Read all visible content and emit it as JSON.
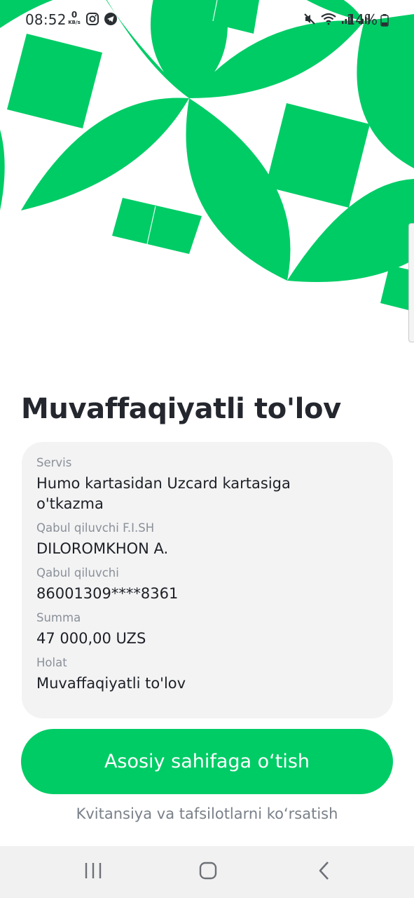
{
  "status_bar": {
    "time": "08:52",
    "net_speed_value": "0",
    "net_speed_unit": "KB/s",
    "battery": "14%",
    "icons_left": [
      "instagram-icon",
      "telegram-icon"
    ],
    "icons_right": [
      "mute-icon",
      "wifi-icon",
      "signal-icon",
      "signal-icon",
      "battery-icon"
    ]
  },
  "colors": {
    "brand_green": "#00cc66",
    "title_text": "#25272f",
    "card_bg": "#f3f3f4",
    "label_text": "#8a9098"
  },
  "title": "Muvaffaqiyatli to'lov",
  "details": [
    {
      "label": "Servis",
      "value": "Humo kartasidan Uzcard kartasiga o'tkazma"
    },
    {
      "label": "Qabul qiluvchi F.I.SH",
      "value": "DILOROMKHON A."
    },
    {
      "label": "Qabul qiluvchi",
      "value": "86001309****8361"
    },
    {
      "label": "Summa",
      "value": "47 000,00 UZS"
    },
    {
      "label": "Holat",
      "value": "Muvaffaqiyatli to'lov"
    }
  ],
  "primary_button": "Asosiy sahifaga o‘tish",
  "secondary_link": "Kvitansiya va tafsilotlarni ko‘rsatish",
  "nav": [
    "recent-apps-icon",
    "home-icon",
    "back-icon"
  ]
}
